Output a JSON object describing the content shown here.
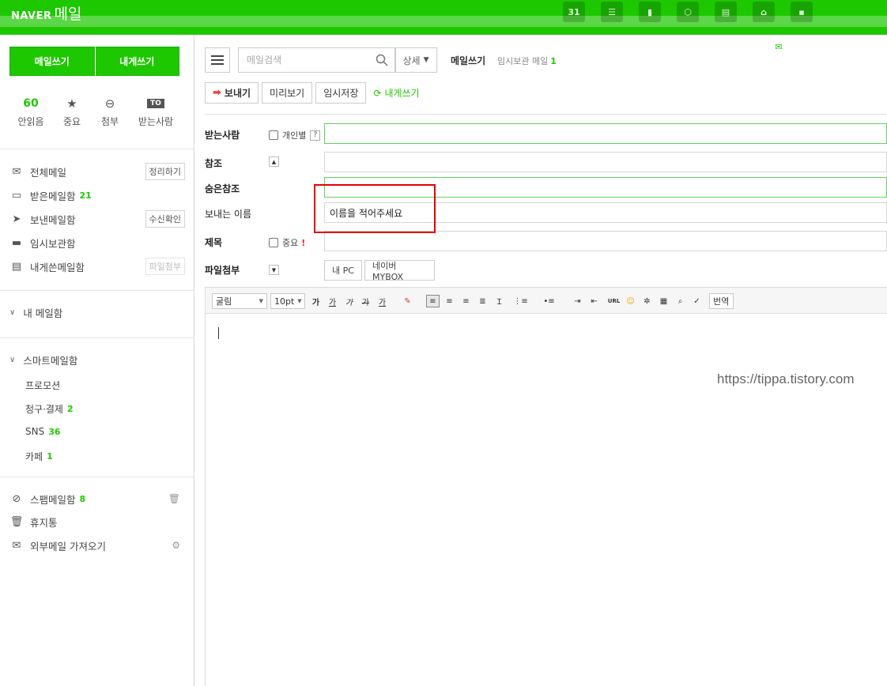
{
  "header": {
    "brand": "NAVER",
    "app": "메일",
    "icons": [
      "mail-icon",
      "calendar-icon",
      "list-icon",
      "contacts-icon",
      "cloud-icon",
      "memo-icon",
      "home-icon",
      "office-icon"
    ],
    "accent_color": "#1ec800"
  },
  "sidebar": {
    "write_button": "메일쓰기",
    "self_write_button": "내게쓰기",
    "quick": {
      "unread_count": "60",
      "unread_label": "안읽음",
      "important_label": "중요",
      "attach_label": "첨부",
      "to_badge": "TO",
      "recipient_label": "받는사람"
    },
    "items": [
      {
        "label": "전체메일",
        "side": "정리하기"
      },
      {
        "label": "받은메일함",
        "count": "21"
      },
      {
        "label": "보낸메일함",
        "side": "수신확인"
      },
      {
        "label": "임시보관함"
      },
      {
        "label": "내게쓴메일함",
        "side": "파일첨부"
      }
    ],
    "my_mailbox": "내 메일함",
    "smart_mailbox": "스마트메일함",
    "smart_items": [
      {
        "label": "프로모션",
        "count": ""
      },
      {
        "label": "청구·결제",
        "count": "2"
      },
      {
        "label": "SNS",
        "count": "36"
      },
      {
        "label": "카페",
        "count": "1"
      }
    ],
    "spam": {
      "label": "스팸메일함",
      "count": "8"
    },
    "trash": "휴지통",
    "external": "외부메일 가져오기"
  },
  "main": {
    "search": {
      "placeholder": "메일검색",
      "detail": "상세"
    },
    "compose_title": "메일쓰기",
    "draft_label": "임시보관 메일",
    "draft_count": "1",
    "actions": {
      "send": "보내기",
      "preview": "미리보기",
      "save": "임시저장",
      "self": "내게쓰기"
    },
    "fields": {
      "to_label": "받는사람",
      "individual": "개인별",
      "help": "?",
      "cc_label": "참조",
      "bcc_label": "숨은참조",
      "sender_label": "보내는 이름",
      "sender_value": "이름을 적어주세요",
      "subject_label": "제목",
      "important": "중요",
      "bang": "!",
      "attach_label": "파일첨부",
      "my_pc": "내 PC",
      "mybox": "네이버 MYBOX"
    },
    "editor": {
      "font": "굴림",
      "size": "10pt",
      "bold": "가",
      "underline": "가",
      "italic": "가",
      "strike": "가",
      "color": "가",
      "url": "URL",
      "translate": "번역"
    },
    "watermark": "https://tippa.tistory.com"
  }
}
